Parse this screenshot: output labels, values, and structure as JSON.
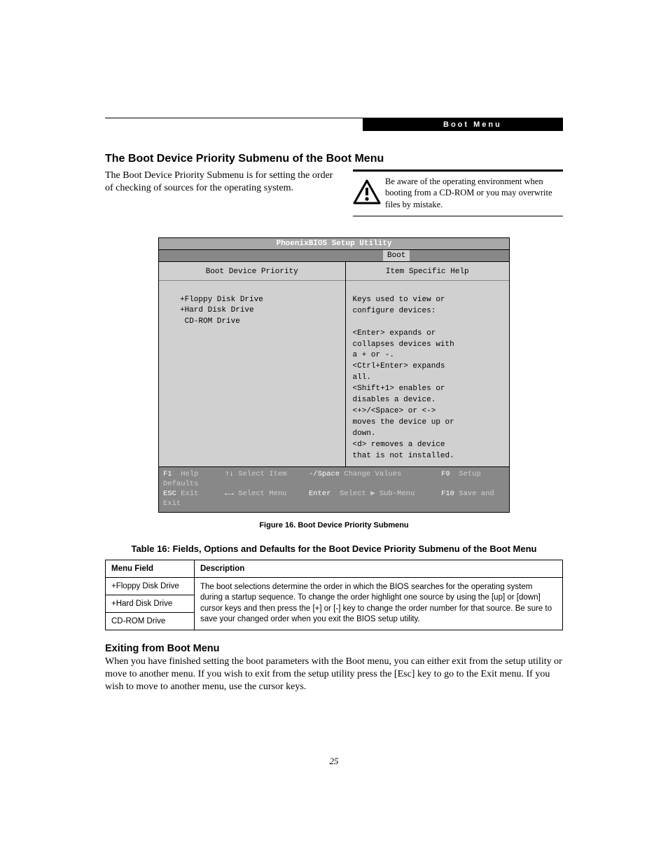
{
  "header": {
    "label": "Boot Menu"
  },
  "section": {
    "title": "The Boot Device Priority Submenu of the Boot Menu",
    "intro": "The Boot Device Priority Submenu is for setting the order of checking of sources for the operating system."
  },
  "warning": {
    "text": "Be aware of the operating environment when booting from a CD-ROM or you may overwrite files by mistake."
  },
  "bios": {
    "title": "PhoenixBIOS Setup Utility",
    "active_tab": "Boot",
    "left_title": "Boot Device Priority",
    "right_title": "Item Specific Help",
    "devices": "+Floppy Disk Drive\n+Hard Disk Drive\n CD-ROM Drive",
    "help_text": "Keys used to view or\nconfigure devices:\n\n<Enter> expands or\ncollapses devices with\na + or -.\n<Ctrl+Enter> expands\nall.\n<Shift+1> enables or\ndisables a device.\n<+>/<Space> or <->\nmoves the device up or\ndown.\n<d> removes a device\nthat is not installed.",
    "footer": {
      "f1": "F1",
      "f1_label": "Help",
      "esc": "ESC",
      "esc_label": "Exit",
      "updown": "↑↓",
      "updown_label": "Select Item",
      "lr": "←→",
      "lr_label": "Select Menu",
      "minus": "-/Space",
      "minus_label": "Change Values",
      "enter": "Enter",
      "enter_label": "Select ▶ Sub-Menu",
      "f9": "F9",
      "f9_label": "Setup Defaults",
      "f10": "F10",
      "f10_label": "Save and Exit"
    }
  },
  "figure_caption": "Figure 16.   Boot Device Priority Submenu",
  "table": {
    "caption": "Table 16: Fields, Options and Defaults for the Boot Device Priority Submenu of the Boot Menu",
    "headers": {
      "col1": "Menu Field",
      "col2": "Description"
    },
    "rows": [
      {
        "field": "+Floppy Disk Drive"
      },
      {
        "field": "+Hard Disk Drive"
      },
      {
        "field": "CD-ROM Drive"
      }
    ],
    "description": "The boot selections determine the order in which the BIOS searches for the operating system during a startup sequence. To change the order highlight one source by using the [up] or [down] cursor keys and then press the [+] or [-] key to change the order number for that source. Be sure to save your changed order when you exit the BIOS setup utility."
  },
  "exit": {
    "title": "Exiting from Boot Menu",
    "body": "When you have finished setting the boot parameters with the Boot menu, you can either exit from the setup utility or move to another menu. If you wish to exit from the setup utility press the [Esc] key to go to the Exit menu. If you wish to move to another menu, use the cursor keys."
  },
  "page_number": "25"
}
